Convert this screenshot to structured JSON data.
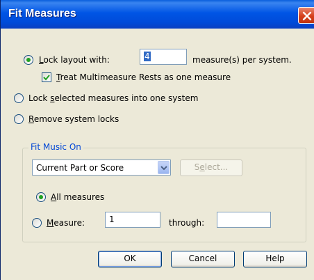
{
  "dialog": {
    "title": "Fit Measures"
  },
  "lock_layout": {
    "label": "Lock layout with:",
    "value": "4",
    "suffix": "measure(s) per system.",
    "checked": true
  },
  "treat_multimeasure": {
    "label": "Treat Multimeasure Rests as one measure",
    "checked": true
  },
  "lock_selected": {
    "label": "Lock selected measures into one system",
    "checked": false
  },
  "remove_locks": {
    "label": "Remove system locks",
    "checked": false
  },
  "fit_music_on": {
    "title": "Fit Music On",
    "scope": {
      "selected": "Current Part or Score"
    },
    "select_button": "Select...",
    "all_measures": {
      "label": "All measures",
      "checked": true
    },
    "measure_range": {
      "label": "Measure:",
      "from_value": "1",
      "through_label": "through:",
      "to_value": ""
    }
  },
  "buttons": {
    "ok": "OK",
    "cancel": "Cancel",
    "help": "Help"
  },
  "colors": {
    "titlebar": "#0055e5",
    "group_title": "#0046d5",
    "radio_dot": "#21a121",
    "close_button": "#d5401c"
  },
  "icons": {
    "close": "close-icon",
    "dropdown": "chevron-down-icon",
    "checkmark": "checkmark-icon"
  }
}
